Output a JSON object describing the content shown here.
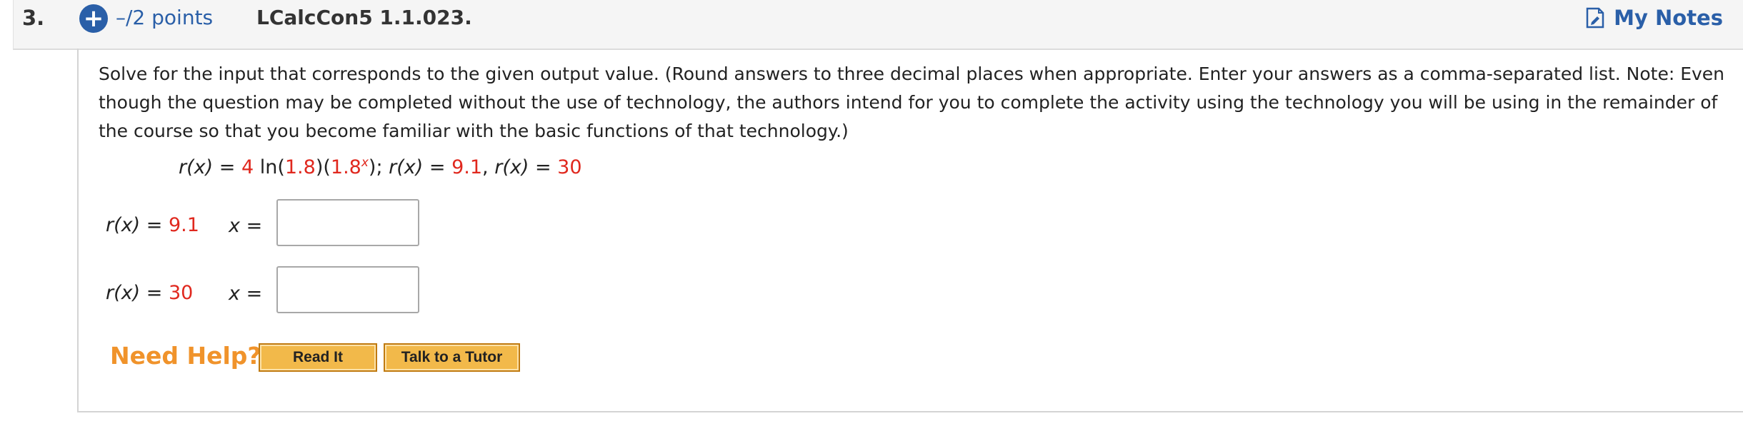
{
  "header": {
    "question_number": "3.",
    "plus_icon": "+",
    "points": "–/2 points",
    "question_id": "LCalcCon5 1.1.023.",
    "my_notes_label": "My Notes",
    "notes_icon": "note-icon"
  },
  "prompt": {
    "text": "Solve for the input that corresponds to the given output value. (Round answers to three decimal places when appropriate. Enter your answers as a comma-separated list. Note: Even though the question may be completed without the use of technology, the authors intend for you to complete the activity using the technology you will be using in the remainder of the course so that you become familiar with the basic functions of that technology.)"
  },
  "equation": {
    "lhs": "r(x)",
    "equals": " = ",
    "coef": "4",
    "ln_open": " ln(",
    "ln_arg": "1.8",
    "mid": ")(",
    "base": "1.8",
    "exp": "x",
    "close": "); ",
    "lhs2": "r(x)",
    "eq2": " = ",
    "val1": "9.1",
    "comma": ", ",
    "lhs3": "r(x)",
    "eq3": " = ",
    "val2": "30"
  },
  "rows": [
    {
      "fn": "r(x)",
      "eq": " = ",
      "value": "9.1",
      "x_label": "x",
      "x_eq": " =",
      "answer": ""
    },
    {
      "fn": "r(x)",
      "eq": " = ",
      "value": "30",
      "x_label": "x",
      "x_eq": " =",
      "answer": ""
    }
  ],
  "help": {
    "label": "Need Help?",
    "read_it": "Read It",
    "talk_tutor": "Talk to a Tutor"
  },
  "colors": {
    "accent_blue": "#2a5fa8",
    "given_value_red": "#e0281e",
    "help_orange": "#f0932b",
    "button_fill": "#f2b94a"
  }
}
